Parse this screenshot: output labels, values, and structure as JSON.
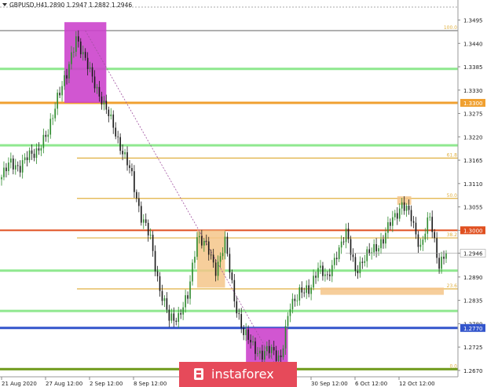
{
  "header": {
    "symbol": "GBPUSD,H4",
    "ohlc": "1.2890 1.2947 1.2882 1.2946"
  },
  "watermark": {
    "text": "instaforex"
  },
  "colors": {
    "bull": "#2e8b2e",
    "bear": "#1b1b1b",
    "magenta_zone": "#cc44cc",
    "orange_zone": "#f5c68a",
    "green_level": "#8fe88f",
    "fib_level": "#e0b040",
    "red_level": "#e05020",
    "blue_level": "#3355cc",
    "orange_level": "#f0a030",
    "gray_level": "#b0b0b0",
    "olive_level": "#6f9a1a",
    "price_tag_orange": "#f0a030",
    "price_tag_red": "#e05020",
    "price_tag_blue": "#3355cc",
    "watermark_bg": "#e64a5a"
  },
  "chart_data": {
    "type": "candlestick",
    "y_ticks": [
      "1.3495",
      "1.3440",
      "1.3385",
      "1.3330",
      "1.3275",
      "1.3220",
      "1.3165",
      "1.3110",
      "1.3055",
      "1.3000",
      "1.2946",
      "1.2890",
      "1.2835",
      "1.2780",
      "1.2725",
      "1.2670"
    ],
    "x_ticks": [
      "21 Aug 2020",
      "27 Aug 12:00",
      "2 Sep 12:00",
      "8 Sep 12:00",
      "30 Sep 12:00",
      "6 Oct 12:00",
      "12 Oct 12:00"
    ],
    "ylim": [
      1.2655,
      1.352
    ],
    "current_price": "1.2946",
    "levels": [
      {
        "kind": "gray",
        "price": 1.347,
        "tag": "",
        "fib": "100.0"
      },
      {
        "kind": "green",
        "price": 1.338,
        "tag": "",
        "fib": ""
      },
      {
        "kind": "orange",
        "price": 1.33,
        "tag": "1.3300",
        "fib": ""
      },
      {
        "kind": "green",
        "price": 1.32,
        "tag": "",
        "fib": ""
      },
      {
        "kind": "fib",
        "price": 1.317,
        "tag": "",
        "fib": "61.8"
      },
      {
        "kind": "fib",
        "price": 1.3075,
        "tag": "",
        "fib": "50.0"
      },
      {
        "kind": "red",
        "price": 1.3,
        "tag": "1.3000",
        "fib": ""
      },
      {
        "kind": "fib",
        "price": 1.2982,
        "tag": "",
        "fib": "38.2"
      },
      {
        "kind": "green",
        "price": 1.2905,
        "tag": "",
        "fib": ""
      },
      {
        "kind": "fib",
        "price": 1.2862,
        "tag": "",
        "fib": "23.6"
      },
      {
        "kind": "green",
        "price": 1.281,
        "tag": "",
        "fib": ""
      },
      {
        "kind": "blue",
        "price": 1.277,
        "tag": "1.2770",
        "fib": ""
      },
      {
        "kind": "olive",
        "price": 1.2673,
        "tag": "",
        "fib": "0.0"
      }
    ],
    "zones": [
      {
        "kind": "magenta",
        "start": 27,
        "end": 45,
        "top": 1.349,
        "bottom": 1.33
      },
      {
        "kind": "orange",
        "start": 84,
        "end": 96,
        "top": 1.3,
        "bottom": 1.2865
      },
      {
        "kind": "magenta",
        "start": 105,
        "end": 123,
        "top": 1.277,
        "bottom": 1.268
      },
      {
        "kind": "orange",
        "start": 137,
        "end": 190,
        "top": 1.2865,
        "bottom": 1.2848
      },
      {
        "kind": "orange",
        "start": 170,
        "end": 176,
        "top": 1.308,
        "bottom": 1.306
      }
    ],
    "close_path": [
      [
        0,
        1.3125
      ],
      [
        4,
        1.316
      ],
      [
        8,
        1.315
      ],
      [
        12,
        1.3175
      ],
      [
        16,
        1.3195
      ],
      [
        20,
        1.3225
      ],
      [
        24,
        1.332
      ],
      [
        28,
        1.336
      ],
      [
        32,
        1.346
      ],
      [
        36,
        1.3395
      ],
      [
        40,
        1.335
      ],
      [
        44,
        1.329
      ],
      [
        48,
        1.325
      ],
      [
        52,
        1.318
      ],
      [
        56,
        1.313
      ],
      [
        60,
        1.303
      ],
      [
        64,
        1.298
      ],
      [
        68,
        1.286
      ],
      [
        72,
        1.279
      ],
      [
        76,
        1.28
      ],
      [
        80,
        1.284
      ],
      [
        84,
        1.299
      ],
      [
        88,
        1.296
      ],
      [
        92,
        1.291
      ],
      [
        96,
        1.297
      ],
      [
        100,
        1.284
      ],
      [
        104,
        1.2755
      ],
      [
        108,
        1.273
      ],
      [
        112,
        1.2705
      ],
      [
        116,
        1.272
      ],
      [
        120,
        1.27
      ],
      [
        124,
        1.282
      ],
      [
        128,
        1.286
      ],
      [
        132,
        1.285
      ],
      [
        136,
        1.292
      ],
      [
        140,
        1.288
      ],
      [
        144,
        1.295
      ],
      [
        148,
        1.299
      ],
      [
        152,
        1.291
      ],
      [
        156,
        1.293
      ],
      [
        160,
        1.296
      ],
      [
        164,
        1.2975
      ],
      [
        168,
        1.303
      ],
      [
        172,
        1.306
      ],
      [
        176,
        1.303
      ],
      [
        180,
        1.296
      ],
      [
        184,
        1.303
      ],
      [
        188,
        1.292
      ],
      [
        191,
        1.2946
      ]
    ],
    "grid": false,
    "legend": "none"
  }
}
